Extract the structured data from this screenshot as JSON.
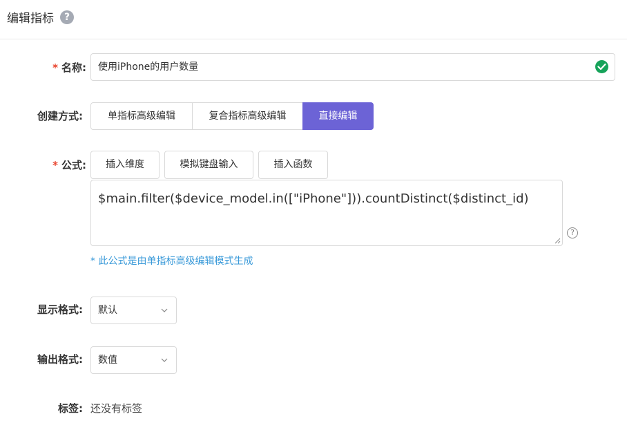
{
  "header": {
    "title": "编辑指标",
    "help_glyph": "?"
  },
  "form": {
    "name": {
      "label": "名称:",
      "required_mark": "*",
      "value": "使用iPhone的用户数量",
      "status_icon": "check-circle-icon"
    },
    "create_method": {
      "label": "创建方式:",
      "options": [
        "单指标高级编辑",
        "复合指标高级编辑",
        "直接编辑"
      ],
      "selected": "直接编辑"
    },
    "formula": {
      "label": "公式:",
      "required_mark": "*",
      "buttons": [
        "插入维度",
        "模拟键盘输入",
        "插入函数"
      ],
      "value": "$main.filter($device_model.in([\"iPhone\"])).countDistinct($distinct_id)",
      "help_glyph": "?",
      "hint": "* 此公式是由单指标高级编辑模式生成"
    },
    "display_format": {
      "label": "显示格式:",
      "value": "默认"
    },
    "output_format": {
      "label": "输出格式:",
      "value": "数值"
    },
    "tags": {
      "label": "标签:",
      "value": "还没有标签"
    }
  },
  "colors": {
    "accent": "#6c63d6",
    "required": "#e9442e",
    "success": "#16a35a",
    "hint": "#3a9ad9"
  }
}
